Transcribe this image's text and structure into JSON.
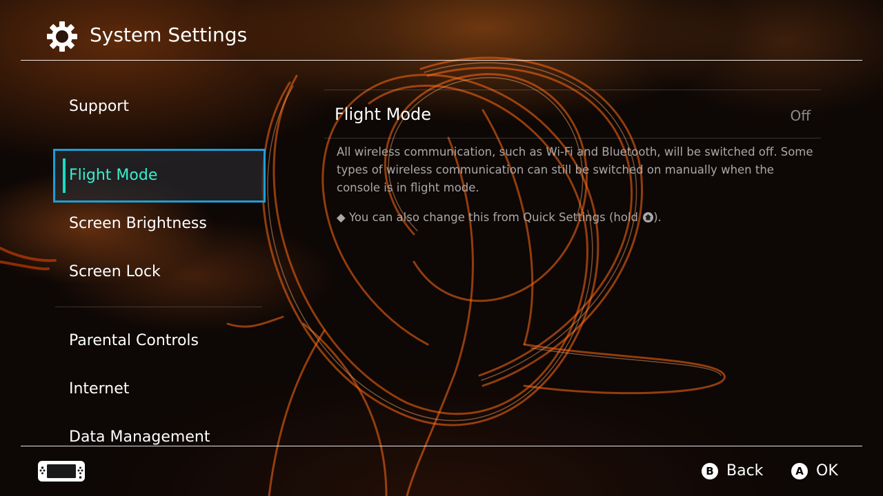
{
  "header": {
    "title": "System Settings",
    "icon": "gear-icon"
  },
  "sidebar": {
    "items": [
      {
        "label": "Support",
        "selected": false
      },
      {
        "label": "Flight Mode",
        "selected": true
      },
      {
        "label": "Screen Brightness",
        "selected": false
      },
      {
        "label": "Screen Lock",
        "selected": false
      },
      {
        "label": "Parental Controls",
        "selected": false
      },
      {
        "label": "Internet",
        "selected": false
      },
      {
        "label": "Data Management",
        "selected": false
      }
    ]
  },
  "panel": {
    "title": "Flight Mode",
    "value": "Off",
    "description": "All wireless communication, such as Wi-Fi and Bluetooth, will be switched off. Some types of wireless communication can still be switched on manually when the console is in flight mode.",
    "note_bullet": "◆",
    "note_text": "You can also change this from Quick Settings (hold",
    "note_icon": "home-button-icon",
    "note_suffix": ")."
  },
  "footer": {
    "console_icon": "console-icon",
    "back": {
      "button": "B",
      "label": "Back"
    },
    "ok": {
      "button": "A",
      "label": "OK"
    }
  },
  "colors": {
    "selection_border": "#1c9fd6",
    "selection_text": "#38f0cf",
    "selection_bar": "#12e0c4",
    "description_text": "#a9a9a9",
    "value_text": "#8c8c8c"
  }
}
